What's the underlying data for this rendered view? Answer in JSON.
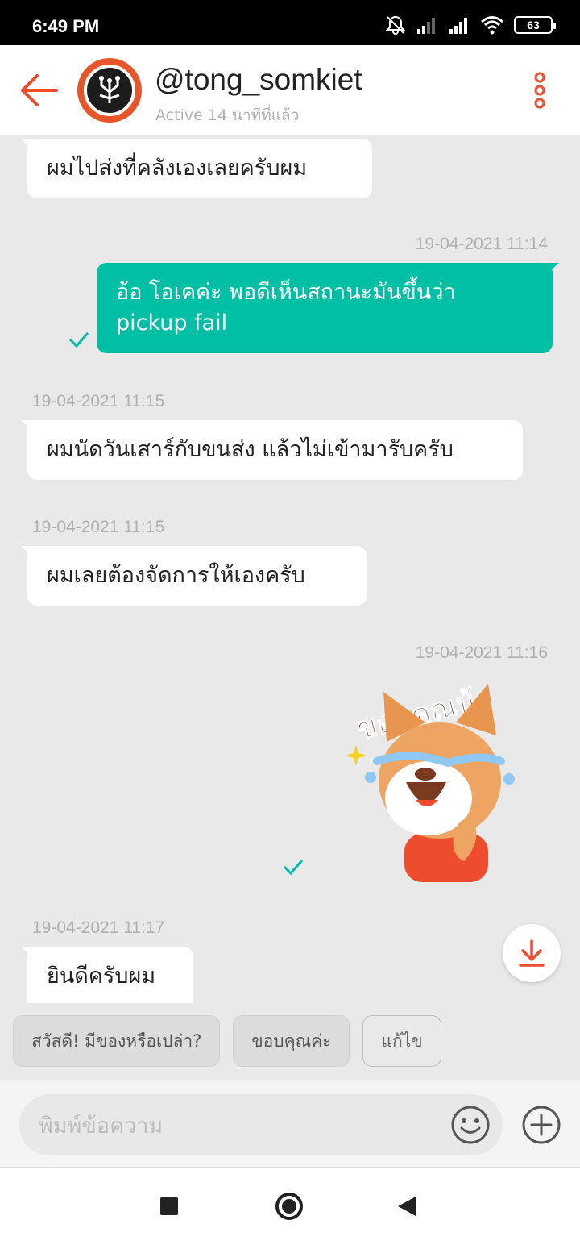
{
  "status_bar": {
    "time": "6:49 PM",
    "battery": "63"
  },
  "header": {
    "username": "@tong_somkiet",
    "active_status": "Active 14 นาทีที่แล้ว"
  },
  "messages": [
    {
      "direction": "in",
      "text": "ผมไปส่งที่คลังเองเลยครับผม"
    },
    {
      "direction": "out",
      "timestamp": "19-04-2021 11:14",
      "text_line1": "อ้อ โอเคค่ะ พอดีเห็นสถานะมันขึ้นว่า",
      "text_line2": "pickup fail",
      "read": true
    },
    {
      "direction": "in",
      "timestamp": "19-04-2021 11:15",
      "text": "ผมนัดวันเสาร์กับขนส่ง แล้วไม่เข้ามารับครับ"
    },
    {
      "direction": "in",
      "timestamp": "19-04-2021 11:15",
      "text": "ผมเลยต้องจัดการให้เองครับ"
    },
    {
      "direction": "out",
      "timestamp": "19-04-2021 11:16",
      "sticker_text": "ขอบคุณน้า",
      "read": true
    },
    {
      "direction": "in",
      "timestamp": "19-04-2021 11:17",
      "text": "ยินดีครับผม"
    }
  ],
  "quick_replies": [
    "สวัสดี! มีของหรือเปล่า?",
    "ขอบคุณค่ะ",
    "แก้ไข"
  ],
  "input": {
    "placeholder": "พิมพ์ข้อความ"
  },
  "colors": {
    "accent": "#ee4d2d",
    "outgoing_bubble": "#00bfa5",
    "background": "#e9e9e9"
  }
}
